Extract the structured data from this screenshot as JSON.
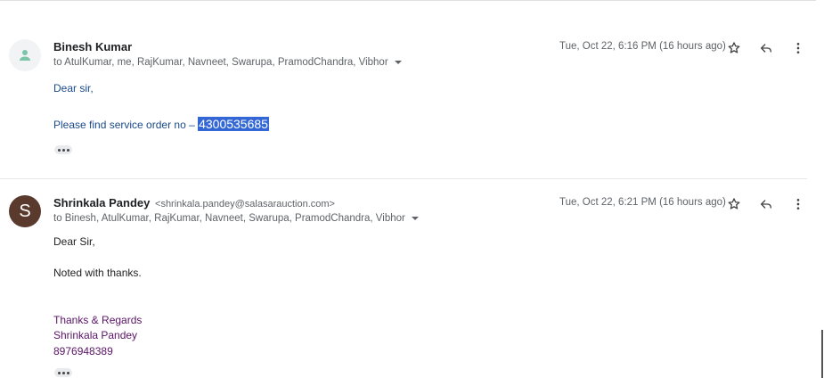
{
  "messages": [
    {
      "sender_name": "Binesh Kumar",
      "sender_email": "",
      "avatar_letter": "",
      "recipients": "to AtulKumar, me, RajKumar, Navneet, Swarupa, PramodChandra, Vibhor",
      "date": "Tue, Oct 22, 6:16 PM (16 hours ago)",
      "greeting": "Dear sir,",
      "body_prefix": "Please find service order no – ",
      "body_highlight": "4300535685"
    },
    {
      "sender_name": "Shrinkala Pandey",
      "sender_email": "<shrinkala.pandey@salasarauction.com>",
      "avatar_letter": "S",
      "recipients": "to Binesh, AtulKumar, RajKumar, Navneet, Swarupa, PramodChandra, Vibhor",
      "date": "Tue, Oct 22, 6:21 PM (16 hours ago)",
      "greeting": "Dear Sir,",
      "body": "Noted with thanks.",
      "signature": {
        "closing": "Thanks & Regards",
        "name": "Shrinkala Pandey",
        "phone": "8976948389"
      }
    }
  ],
  "icons": {
    "star": "star-icon",
    "reply": "reply-icon",
    "more": "more-vert-icon",
    "avatar": "person-icon",
    "expand": "ellipsis-icon"
  },
  "colors": {
    "avatar_letter_bg": "#5b3a2e",
    "selection_highlight": "#3367d6",
    "body_blue": "#1a4a8a",
    "signature_purple": "#5b1467"
  }
}
